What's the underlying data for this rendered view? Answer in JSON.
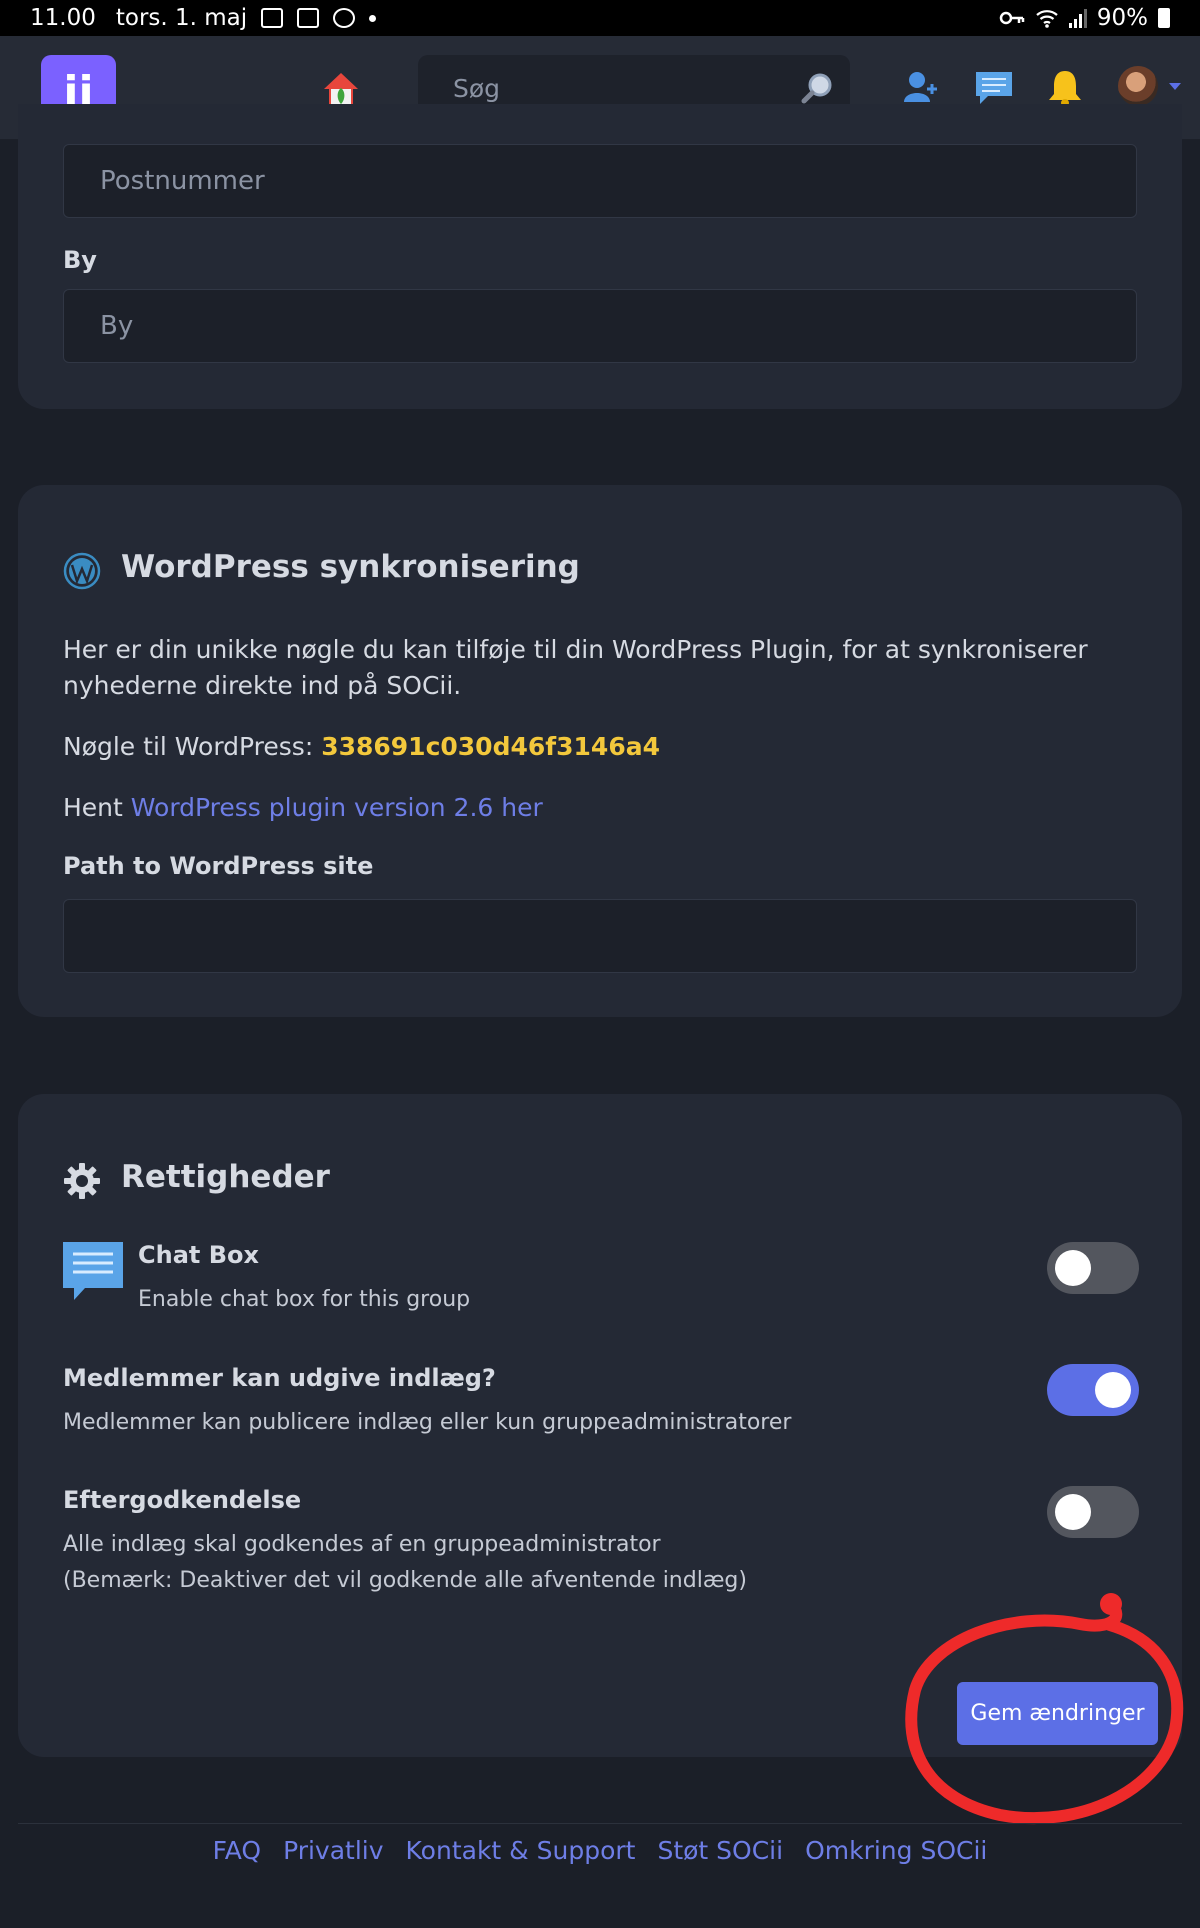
{
  "status_bar": {
    "time": "11.00",
    "date": "tors. 1. maj",
    "battery": "90%"
  },
  "nav": {
    "logo_text": "ii",
    "search_placeholder": "Søg",
    "icons": [
      "home-icon",
      "search-icon",
      "add-friend-icon",
      "messages-icon",
      "bell-icon",
      "avatar",
      "chevron-down-icon"
    ]
  },
  "address": {
    "postal_placeholder": "Postnummer",
    "city_label": "By",
    "city_placeholder": "By"
  },
  "wordpress": {
    "title": "WordPress synkronisering",
    "description": "Her er din unikke nøgle du kan tilføje til din WordPress Plugin, for at synkroniserer nyhederne direkte ind på SOCii.",
    "key_label": "Nøgle til WordPress: ",
    "key_value": "338691c030d46f3146a4",
    "download_prefix": "Hent ",
    "download_link": "WordPress plugin version 2.6 her",
    "path_label": "Path to WordPress site",
    "path_value": ""
  },
  "permissions": {
    "title": "Rettigheder",
    "items": [
      {
        "title": "Chat Box",
        "desc": "Enable chat box for this group",
        "enabled": false
      },
      {
        "title": "Medlemmer kan udgive indlæg?",
        "desc": "Medlemmer kan publicere indlæg eller kun gruppeadministratorer",
        "enabled": true
      },
      {
        "title": "Eftergodkendelse",
        "desc": "Alle indlæg skal godkendes af en gruppeadministrator",
        "desc2": "(Bemærk: Deaktiver det vil godkende alle afventende indlæg)",
        "enabled": false
      }
    ],
    "save_label": "Gem ændringer"
  },
  "annotation_color": "#ee2a2a",
  "colors": {
    "accent": "#5c6fe6",
    "logo": "#7b61ff",
    "key": "#f3c83c"
  },
  "footer": {
    "links": [
      "FAQ",
      "Privatliv",
      "Kontakt & Support",
      "Støt SOCii",
      "Omkring SOCii"
    ]
  }
}
